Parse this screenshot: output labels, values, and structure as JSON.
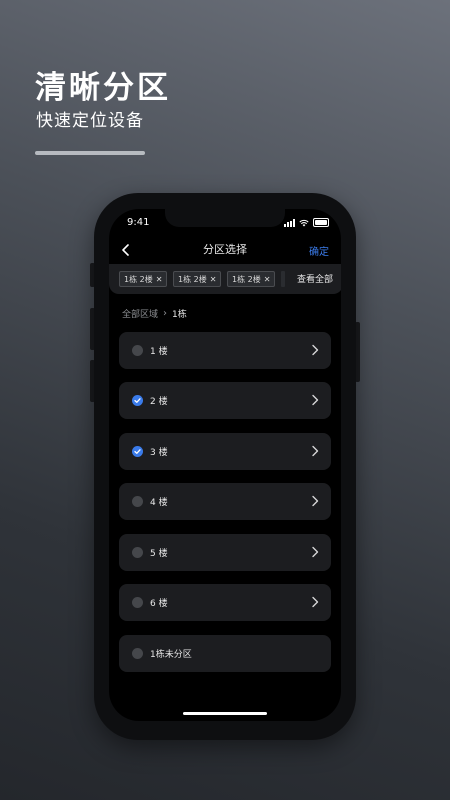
{
  "promo": {
    "title": "清晰分区",
    "subtitle": "快速定位设备"
  },
  "status_bar": {
    "time": "9:41"
  },
  "nav": {
    "title": "分区选择",
    "confirm_label": "确定"
  },
  "selected_tags": [
    {
      "label": "1栋 2楼"
    },
    {
      "label": "1栋 2楼"
    },
    {
      "label": "1栋 2楼"
    }
  ],
  "view_all_label": "查看全部",
  "breadcrumb": {
    "root": "全部区域",
    "current": "1栋"
  },
  "floors": [
    {
      "label": "1 楼",
      "checked": false,
      "has_children": true
    },
    {
      "label": "2 楼",
      "checked": true,
      "has_children": true
    },
    {
      "label": "3 楼",
      "checked": true,
      "has_children": true
    },
    {
      "label": "4 楼",
      "checked": false,
      "has_children": true
    },
    {
      "label": "5 楼",
      "checked": false,
      "has_children": true
    },
    {
      "label": "6 楼",
      "checked": false,
      "has_children": true
    },
    {
      "label": "1栋未分区",
      "checked": false,
      "has_children": false
    }
  ],
  "colors": {
    "accent": "#3a7bea",
    "card": "#1c1d20",
    "screen": "#000000"
  }
}
